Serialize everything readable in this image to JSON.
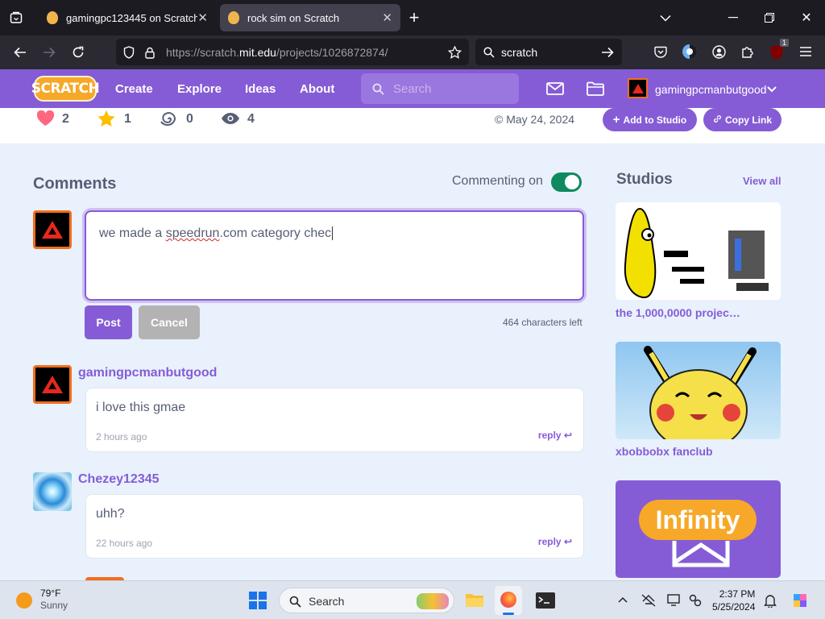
{
  "browser": {
    "tabs": [
      {
        "title": "gamingpc123445 on Scratch"
      },
      {
        "title": "rock sim on Scratch"
      }
    ],
    "url_prefix": "https://scratch.",
    "url_domain": "mit.edu",
    "url_path": "/projects/1026872874/",
    "search_value": "scratch",
    "ext_badge": "1"
  },
  "scratch_nav": {
    "logo": "SCRATCH",
    "items": [
      "Create",
      "Explore",
      "Ideas",
      "About"
    ],
    "search_placeholder": "Search",
    "username": "gamingpcmanbutgood"
  },
  "stats": {
    "loves": "2",
    "favorites": "1",
    "remixes": "0",
    "views": "4",
    "date": "© May 24, 2024",
    "add_to_studio": "Add to Studio",
    "copy_link": "Copy Link"
  },
  "comments": {
    "title": "Comments",
    "commenting_label": "Commenting on",
    "draft_before": "we made a ",
    "draft_misspelled": "speedrun",
    "draft_after": ".com category chec",
    "post_label": "Post",
    "cancel_label": "Cancel",
    "chars_left": "464 characters left",
    "items": [
      {
        "user": "gamingpcmanbutgood",
        "text": "i love this gmae",
        "time": "2 hours ago",
        "reply": "reply"
      },
      {
        "user": "Chezey12345",
        "text": "uhh?",
        "time": "22 hours ago",
        "reply": "reply"
      }
    ]
  },
  "studios": {
    "title": "Studios",
    "view_all": "View all",
    "items": [
      {
        "name": "the 1,000,0000 projec…"
      },
      {
        "name": "xbobbobx fanclub"
      },
      {
        "name": "",
        "thumb_text": "Infinity"
      }
    ]
  },
  "taskbar": {
    "weather_temp": "79°F",
    "weather_desc": "Sunny",
    "search_label": "Search",
    "time": "2:37 PM",
    "date": "5/25/2024"
  },
  "colors": {
    "scratch_purple": "#855cd6",
    "toggle_green": "#0f8a5e",
    "page_bg": "#e9f1fc"
  }
}
